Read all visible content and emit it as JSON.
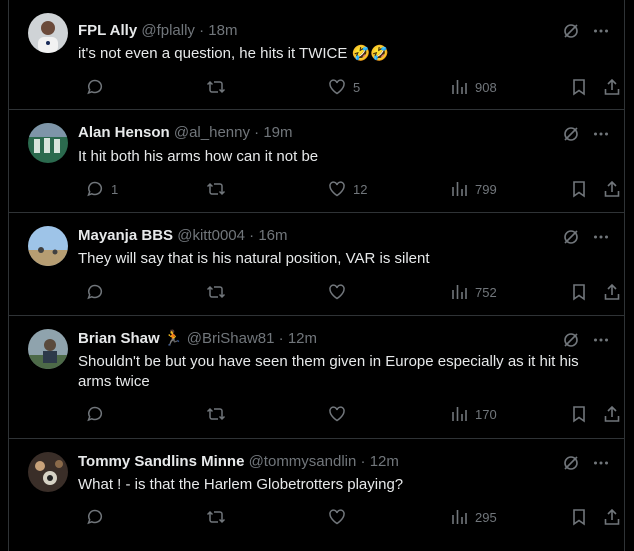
{
  "tweets": [
    {
      "name": "FPL Ally",
      "handle": "@fplally",
      "time": "18m",
      "text": "it's not even a question, he hits it TWICE 🤣🤣",
      "replies": "",
      "reposts": "",
      "likes": "5",
      "views": "908"
    },
    {
      "name": "Alan Henson",
      "handle": "@al_henny",
      "time": "19m",
      "text": "It hit both his arms how can it not be",
      "replies": "1",
      "reposts": "",
      "likes": "12",
      "views": "799"
    },
    {
      "name": "Mayanja BBS",
      "handle": "@kitt0004",
      "time": "16m",
      "text": "They will say that is his natural position, VAR is silent",
      "replies": "",
      "reposts": "",
      "likes": "",
      "views": "752"
    },
    {
      "name": "Brian Shaw",
      "name_emoji": "🏃",
      "handle": "@BriShaw81",
      "time": "12m",
      "text": "Shouldn't be but you have seen them given in Europe especially as it hit his arms twice",
      "replies": "",
      "reposts": "",
      "likes": "",
      "views": "170"
    },
    {
      "name": "Tommy Sandlins Minne",
      "handle": "@tommysandlin",
      "time": "12m",
      "text": "What ! - is that the Harlem Globetrotters playing?",
      "replies": "",
      "reposts": "",
      "likes": "",
      "views": "295"
    }
  ],
  "separator": "·",
  "colors": {
    "background": "#000000",
    "text": "#e7e9ea",
    "muted": "#71767b",
    "border": "#2f3336"
  },
  "icons": [
    "grok-icon",
    "more-icon",
    "reply-icon",
    "repost-icon",
    "like-icon",
    "views-icon",
    "bookmark-icon",
    "share-icon"
  ]
}
